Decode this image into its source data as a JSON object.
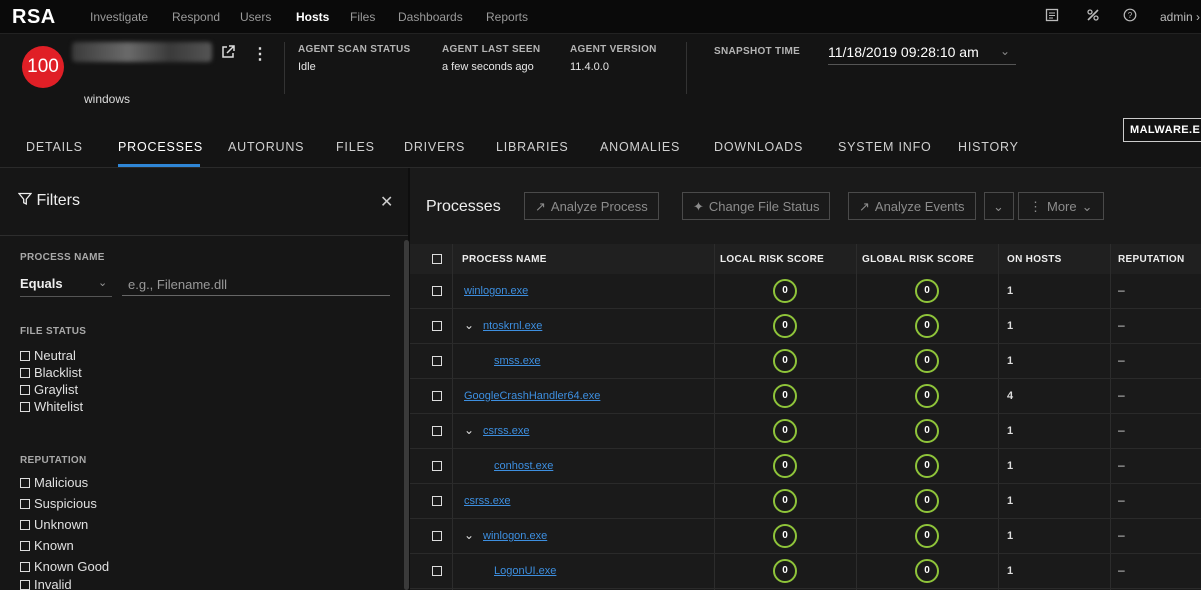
{
  "nav": {
    "logo": "RSA",
    "items": [
      "Investigate",
      "Respond",
      "Users",
      "Hosts",
      "Files",
      "Dashboards",
      "Reports"
    ],
    "active": "Hosts",
    "user": "admin ›",
    "icons": [
      "notes-icon",
      "tools-icon",
      "help-icon"
    ]
  },
  "host": {
    "risk_score": "100",
    "os": "windows",
    "scan_status_label": "AGENT SCAN STATUS",
    "scan_status": "Idle",
    "last_seen_label": "AGENT LAST SEEN",
    "last_seen": "a few seconds ago",
    "version_label": "AGENT VERSION",
    "version": "11.4.0.0",
    "snapshot_label": "SNAPSHOT TIME",
    "snapshot": "11/18/2019 09:28:10 am"
  },
  "tabs": [
    "DETAILS",
    "PROCESSES",
    "AUTORUNS",
    "FILES",
    "DRIVERS",
    "LIBRARIES",
    "ANOMALIES",
    "DOWNLOADS",
    "SYSTEM INFO",
    "HISTORY"
  ],
  "active_tab": "PROCESSES",
  "malware_button": "MALWARE.E",
  "filters": {
    "title": "Filters",
    "process_name_label": "PROCESS NAME",
    "operator": "Equals",
    "placeholder": "e.g., Filename.dll",
    "file_status_label": "FILE STATUS",
    "file_status": [
      "Neutral",
      "Blacklist",
      "Graylist",
      "Whitelist"
    ],
    "reputation_label": "REPUTATION",
    "reputation": [
      "Malicious",
      "Suspicious",
      "Unknown",
      "Known",
      "Known Good",
      "Invalid"
    ]
  },
  "processes": {
    "title": "Processes",
    "buttons": {
      "analyze_process": "Analyze Process",
      "change_file_status": "Change File Status",
      "analyze_events": "Analyze Events",
      "more": "More"
    },
    "columns": [
      "PROCESS NAME",
      "LOCAL RISK SCORE",
      "GLOBAL RISK SCORE",
      "ON HOSTS",
      "REPUTATION"
    ],
    "rows": [
      {
        "name": "winlogon.exe",
        "level": 0,
        "expand": false,
        "local": "0",
        "global": "0",
        "hosts": "1",
        "rep": "–"
      },
      {
        "name": "ntoskrnl.exe",
        "level": 0,
        "expand": true,
        "local": "0",
        "global": "0",
        "hosts": "1",
        "rep": "–"
      },
      {
        "name": "smss.exe",
        "level": 1,
        "expand": false,
        "local": "0",
        "global": "0",
        "hosts": "1",
        "rep": "–"
      },
      {
        "name": "GoogleCrashHandler64.exe",
        "level": 0,
        "expand": false,
        "local": "0",
        "global": "0",
        "hosts": "4",
        "rep": "–"
      },
      {
        "name": "csrss.exe",
        "level": 0,
        "expand": true,
        "local": "0",
        "global": "0",
        "hosts": "1",
        "rep": "–"
      },
      {
        "name": "conhost.exe",
        "level": 1,
        "expand": false,
        "local": "0",
        "global": "0",
        "hosts": "1",
        "rep": "–"
      },
      {
        "name": "csrss.exe",
        "level": 0,
        "expand": false,
        "local": "0",
        "global": "0",
        "hosts": "1",
        "rep": "–"
      },
      {
        "name": "winlogon.exe",
        "level": 0,
        "expand": true,
        "local": "0",
        "global": "0",
        "hosts": "1",
        "rep": "–"
      },
      {
        "name": "LogonUI.exe",
        "level": 1,
        "expand": false,
        "local": "0",
        "global": "0",
        "hosts": "1",
        "rep": "–"
      }
    ]
  }
}
